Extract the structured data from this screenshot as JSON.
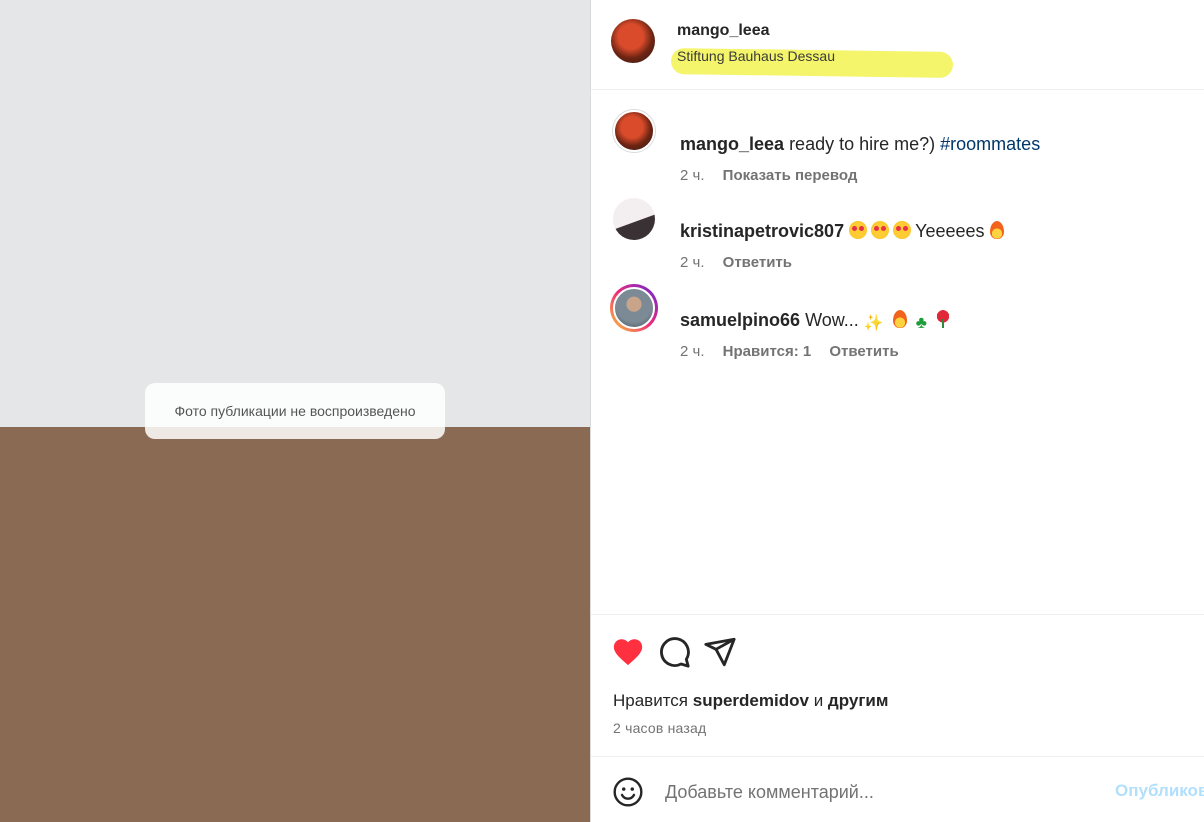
{
  "media": {
    "notice": "Фото публикации не воспроизведено"
  },
  "header": {
    "username": "mango_leea",
    "location": "Stiftung Bauhaus Dessau"
  },
  "comments": [
    {
      "username": "mango_leea",
      "text": "ready to hire me?)",
      "hashtag": "#roommates",
      "time": "2 ч.",
      "action": "Показать перевод"
    },
    {
      "username": "kristinapetrovic807",
      "text": "Yeeeees",
      "time": "2 ч.",
      "action": "Ответить"
    },
    {
      "username": "samuelpino66",
      "text": "Wow...",
      "time": "2 ч.",
      "likes": "Нравится: 1",
      "action": "Ответить"
    }
  ],
  "icons": {
    "like": "heart-icon",
    "comment": "comment-icon",
    "share": "share-icon",
    "emoji": "smile-icon"
  },
  "colors": {
    "like_red": "#ff3040",
    "link_blue": "#00376b",
    "publish_disabled": "#b2dffc",
    "location_highlight": "#f4f56a"
  },
  "likes": {
    "prefix": "Нравится",
    "user": "superdemidov",
    "conj": "и",
    "others": "другим"
  },
  "timestamp": "2 часов назад",
  "add_comment": {
    "placeholder": "Добавьте комментарий...",
    "publish": "Опубликовать"
  }
}
